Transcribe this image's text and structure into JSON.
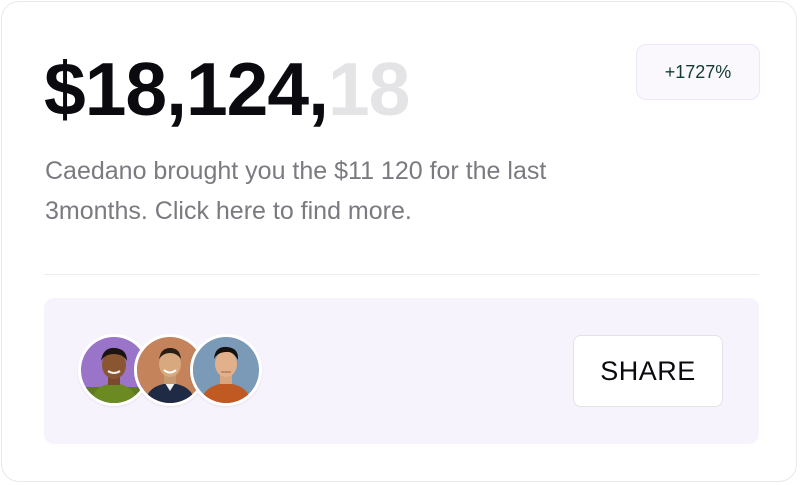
{
  "card": {
    "amount_main": "$18,124,",
    "amount_faded": "18",
    "badge": "+1727%",
    "description": "Caedano brought you the $11 120 for the last 3months. Click here to find more.",
    "share_label": "SHARE",
    "avatars": [
      {
        "name": "avatar-1",
        "bg": "#9a74c9"
      },
      {
        "name": "avatar-2",
        "bg": "#c4835a"
      },
      {
        "name": "avatar-3",
        "bg": "#7b9ab8"
      }
    ]
  },
  "colors": {
    "amount": "#0b0b0f",
    "amount_faded": "#e4e4e7",
    "badge_text": "#123b2e",
    "panel_bg": "#f7f3fd",
    "description": "#7a7a80"
  }
}
